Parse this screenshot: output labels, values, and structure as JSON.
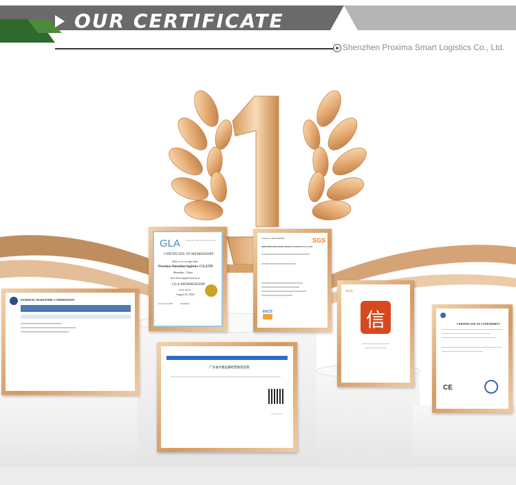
{
  "header": {
    "title": "OUR CERTIFICATE",
    "company": "Shenzhen Proxima Smart Logistics Co., Ltd."
  },
  "trophy": {
    "number": "1"
  },
  "certificates": {
    "gla": {
      "logo": "GLA",
      "logo_sub": "GLOBAL LOGISTICS ALLIANCE",
      "heading": "CERTIFICATE OF MEMBERSHIP",
      "certify": "This is to certify that",
      "company": "Proxima Shenzhen logistics CO.,LTD",
      "location": "Shenzhen , China",
      "approved": "has been approved as a",
      "membership": "GLA MEMBERSHIP",
      "date_label": "DATE VALID",
      "date": "August 29, 2024",
      "footer_left": "GLA CO.,LTD",
      "footer_mid": "President",
      "seal_color": "#c9a227"
    },
    "sgs": {
      "brand": "SGS",
      "top_line": "Certificate GB21/00000009",
      "company": "SHENZHEN PROXIMA SMART LOGISTICS CO., LTD.",
      "badge": "EKCS"
    },
    "fmc": {
      "heading": "FEDERAL MARITIME COMMISSION"
    },
    "cn": {
      "title": "广东省水路运输经营备案证明"
    },
    "credit": {
      "seal_char": "信",
      "label": "AAA"
    },
    "ce": {
      "heading": "CERTIFICATE OF CONFORMITY",
      "mark": "CE"
    }
  }
}
